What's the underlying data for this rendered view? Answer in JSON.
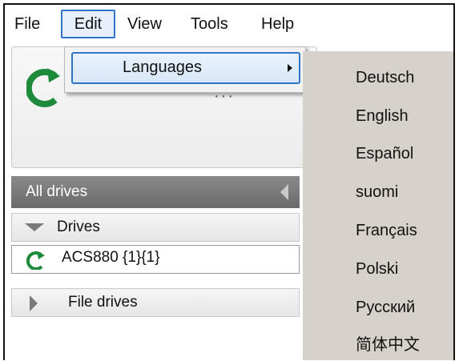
{
  "menubar": {
    "items": [
      "File",
      "Edit",
      "View",
      "Tools",
      "Help"
    ]
  },
  "top_panel": {
    "dots": "···"
  },
  "drives_panel": {
    "header": "All drives",
    "drives_group": "Drives",
    "drive_item": "ACS880 {1}{1}",
    "file_drives_group": "File drives"
  },
  "edit_menu": {
    "languages_label": "Languages"
  },
  "languages_submenu": {
    "items": [
      "Deutsch",
      "English",
      "Español",
      "suomi",
      "Français",
      "Polski",
      "Русский",
      "简体中文"
    ]
  },
  "colors": {
    "accent": "#2f74c8",
    "refresh_icon": "#1e8a3c",
    "submenu_bg": "#d6d1cb"
  }
}
